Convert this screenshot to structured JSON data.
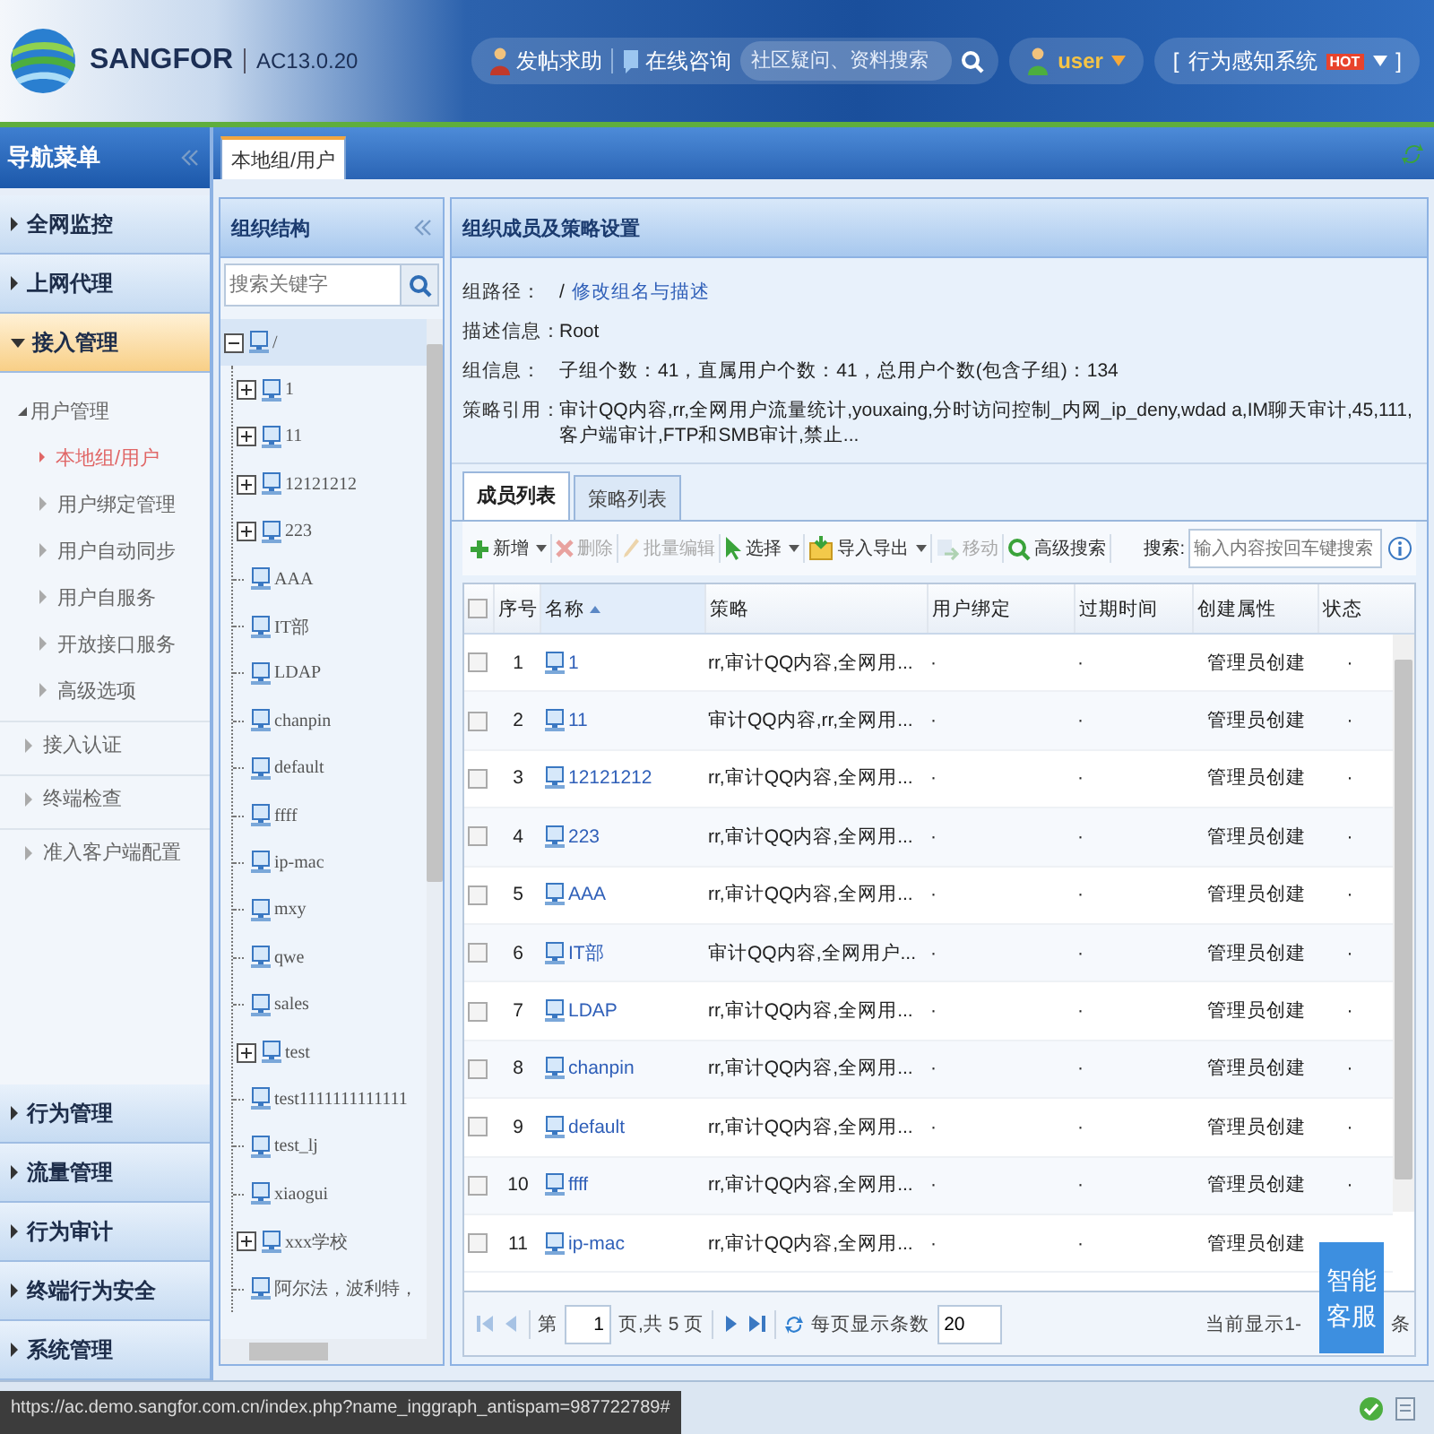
{
  "header": {
    "logo": "SANGFOR",
    "version": "AC13.0.20",
    "links": [
      {
        "label": "发帖求助"
      },
      {
        "label": "在线咨询"
      }
    ],
    "search": {
      "placeholder": "社区疑问、资料搜索"
    },
    "user": "user",
    "system": {
      "bracket_left": "[",
      "label": "行为感知系统",
      "badge": "HOT",
      "bracket_right": "]"
    }
  },
  "nav": {
    "title": "导航菜单",
    "items": [
      {
        "label": "全网监控",
        "expanded": false
      },
      {
        "label": "上网代理",
        "expanded": false
      },
      {
        "label": "接入管理",
        "expanded": true,
        "children": [
          {
            "label": "用户管理",
            "expanded": true,
            "children": [
              {
                "label": "本地组/用户",
                "selected": true
              },
              {
                "label": "用户绑定管理",
                "selected": false
              },
              {
                "label": "用户自动同步",
                "selected": false
              },
              {
                "label": "用户自服务",
                "selected": false
              },
              {
                "label": "开放接口服务",
                "selected": false
              },
              {
                "label": "高级选项",
                "selected": false
              }
            ]
          },
          {
            "label": "接入认证",
            "expanded": false
          },
          {
            "label": "终端检查",
            "expanded": false
          },
          {
            "label": "准入客户端配置",
            "expanded": false
          }
        ]
      },
      {
        "label": "行为管理",
        "expanded": false
      },
      {
        "label": "流量管理",
        "expanded": false
      },
      {
        "label": "行为审计",
        "expanded": false
      },
      {
        "label": "终端行为安全",
        "expanded": false
      },
      {
        "label": "系统管理",
        "expanded": false
      }
    ]
  },
  "page_tabs": [
    {
      "label": "本地组/用户",
      "selected": true
    }
  ],
  "tree_panel": {
    "title": "组织结构",
    "search": {
      "placeholder": "搜索关键字"
    },
    "root": {
      "label": "/",
      "expanded": true,
      "selected": true,
      "children": [
        {
          "label": "1",
          "kind": "expandable"
        },
        {
          "label": "11",
          "kind": "expandable"
        },
        {
          "label": "12121212",
          "kind": "expandable"
        },
        {
          "label": "223",
          "kind": "expandable"
        },
        {
          "label": "AAA",
          "kind": "leaf"
        },
        {
          "label": "IT部",
          "kind": "leaf"
        },
        {
          "label": "LDAP",
          "kind": "leaf"
        },
        {
          "label": "chanpin",
          "kind": "leaf"
        },
        {
          "label": "default",
          "kind": "leaf"
        },
        {
          "label": "ffff",
          "kind": "leaf"
        },
        {
          "label": "ip-mac",
          "kind": "leaf"
        },
        {
          "label": "mxy",
          "kind": "leaf"
        },
        {
          "label": "qwe",
          "kind": "leaf"
        },
        {
          "label": "sales",
          "kind": "leaf"
        },
        {
          "label": "test",
          "kind": "expandable"
        },
        {
          "label": "test1111111111111",
          "kind": "leaf"
        },
        {
          "label": "test_lj",
          "kind": "leaf"
        },
        {
          "label": "xiaogui",
          "kind": "leaf"
        },
        {
          "label": "xxx学校",
          "kind": "expandable"
        },
        {
          "label": "阿尔法，波利特，",
          "kind": "leaf"
        }
      ]
    }
  },
  "main": {
    "title": "组织成员及策略设置",
    "info": [
      {
        "label": "组路径：",
        "value": "/",
        "link": "修改组名与描述"
      },
      {
        "label": "描述信息：",
        "value": "Root"
      },
      {
        "label": "组信息：",
        "value": "子组个数：41，直属用户个数：41，总用户个数(包含子组)：134"
      },
      {
        "label": "策略引用：",
        "value": "审计QQ内容,rr,全网用户流量统计,youxaing,分时访问控制_内网_ip_deny,wdad a,IM聊天审计,45,111,客户端审计,FTP和SMB审计,禁止..."
      }
    ],
    "tabs": [
      {
        "label": "成员列表",
        "selected": true
      },
      {
        "label": "策略列表",
        "selected": false
      }
    ],
    "toolbar": [
      {
        "label": "新增",
        "disabled": false,
        "dropdown": true
      },
      {
        "label": "删除",
        "disabled": true,
        "dropdown": false
      },
      {
        "label": "批量编辑",
        "disabled": true,
        "dropdown": false
      },
      {
        "label": "选择",
        "disabled": false,
        "dropdown": true
      },
      {
        "label": "导入导出",
        "disabled": false,
        "dropdown": true
      },
      {
        "label": "移动",
        "disabled": true,
        "dropdown": false
      },
      {
        "label": "高级搜索",
        "disabled": false,
        "dropdown": false
      }
    ],
    "search": {
      "label": "搜索:",
      "placeholder": "输入内容按回车键搜索"
    },
    "table": {
      "select_all_checked": false,
      "columns": [
        {
          "label": "序号",
          "sorted": false
        },
        {
          "label": "名称",
          "sorted": true
        },
        {
          "label": "策略",
          "sorted": false
        },
        {
          "label": "用户绑定",
          "sorted": false
        },
        {
          "label": "过期时间",
          "sorted": false
        },
        {
          "label": "创建属性",
          "sorted": false
        },
        {
          "label": "状态",
          "sorted": false
        }
      ],
      "rows": [
        {
          "checked": false,
          "cells": [
            "1",
            "1",
            "rr,审计QQ内容,全网用...",
            "·",
            "·",
            "管理员创建",
            "·"
          ]
        },
        {
          "checked": false,
          "cells": [
            "2",
            "11",
            "审计QQ内容,rr,全网用...",
            "·",
            "·",
            "管理员创建",
            "·"
          ]
        },
        {
          "checked": false,
          "cells": [
            "3",
            "12121212",
            "rr,审计QQ内容,全网用...",
            "·",
            "·",
            "管理员创建",
            "·"
          ]
        },
        {
          "checked": false,
          "cells": [
            "4",
            "223",
            "rr,审计QQ内容,全网用...",
            "·",
            "·",
            "管理员创建",
            "·"
          ]
        },
        {
          "checked": false,
          "cells": [
            "5",
            "AAA",
            "rr,审计QQ内容,全网用...",
            "·",
            "·",
            "管理员创建",
            "·"
          ]
        },
        {
          "checked": false,
          "cells": [
            "6",
            "IT部",
            "审计QQ内容,全网用户...",
            "·",
            "·",
            "管理员创建",
            "·"
          ]
        },
        {
          "checked": false,
          "cells": [
            "7",
            "LDAP",
            "rr,审计QQ内容,全网用...",
            "·",
            "·",
            "管理员创建",
            "·"
          ]
        },
        {
          "checked": false,
          "cells": [
            "8",
            "chanpin",
            "rr,审计QQ内容,全网用...",
            "·",
            "·",
            "管理员创建",
            "·"
          ]
        },
        {
          "checked": false,
          "cells": [
            "9",
            "default",
            "rr,审计QQ内容,全网用...",
            "·",
            "·",
            "管理员创建",
            "·"
          ]
        },
        {
          "checked": false,
          "cells": [
            "10",
            "ffff",
            "rr,审计QQ内容,全网用...",
            "·",
            "·",
            "管理员创建",
            "·"
          ]
        },
        {
          "checked": false,
          "cells": [
            "11",
            "ip-mac",
            "rr,审计QQ内容,全网用...",
            "·",
            "·",
            "管理员创建"
          ]
        }
      ]
    },
    "pager": {
      "back_disabled": true,
      "page_prefix": "第",
      "page": "1",
      "page_suffix": "页,共 5 页",
      "page_size_label": "每页显示条数",
      "page_size": "20",
      "summary": "当前显示1-",
      "summary_end": "条"
    },
    "assistant": {
      "label": "智能客服"
    }
  },
  "status_bar": {
    "url": "https://ac.demo.sangfor.com.cn/index.php?name_inggraph_antispam=987722789#"
  }
}
